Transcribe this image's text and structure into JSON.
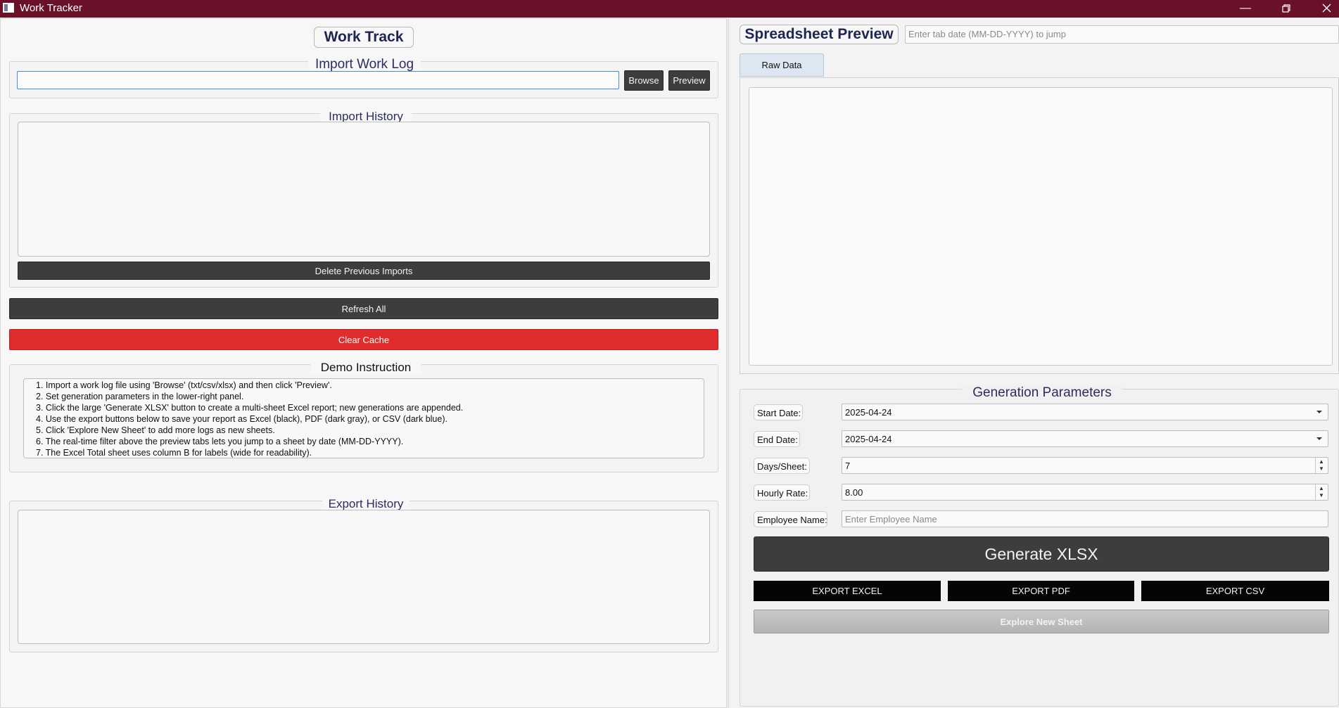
{
  "window": {
    "title": "Work Tracker"
  },
  "left": {
    "heading": "Work Track",
    "import": {
      "title": "Import Work Log",
      "path_value": "",
      "browse_label": "Browse",
      "preview_label": "Preview"
    },
    "import_history": {
      "title": "Import History",
      "delete_label": "Delete Previous Imports"
    },
    "refresh_label": "Refresh All",
    "clear_cache_label": "Clear Cache",
    "demo": {
      "title": "Demo Instruction",
      "lines": [
        "1. Import a work log file using 'Browse' (txt/csv/xlsx) and then click 'Preview'.",
        "2. Set generation parameters in the lower-right panel.",
        "3. Click the large 'Generate XLSX' button to create a multi-sheet Excel report; new generations are appended.",
        "4. Use the export buttons below to save your report as Excel (black), PDF (dark gray), or CSV (dark blue).",
        "5. Click 'Explore New Sheet' to add more logs as new sheets.",
        "6. The real-time filter above the preview tabs lets you jump to a sheet by date (MM-DD-YYYY).",
        "7. The Excel Total sheet uses column B for labels (wide for readability)."
      ]
    },
    "export_history": {
      "title": "Export History"
    }
  },
  "right": {
    "heading": "Spreadsheet Preview",
    "jump_placeholder": "Enter tab date (MM-DD-YYYY) to jump",
    "tabs": [
      {
        "label": "Raw Data"
      }
    ],
    "params": {
      "title": "Generation Parameters",
      "start_label": "Start Date:",
      "start_value": "2025-04-24",
      "end_label": "End Date:",
      "end_value": "2025-04-24",
      "days_label": "Days/Sheet:",
      "days_value": "7",
      "rate_label": "Hourly Rate:",
      "rate_value": "8.00",
      "name_label": "Employee Name:",
      "name_placeholder": "Enter Employee Name"
    },
    "generate_label": "Generate XLSX",
    "export_excel_label": "EXPORT EXCEL",
    "export_pdf_label": "EXPORT PDF",
    "export_csv_label": "EXPORT CSV",
    "explore_label": "Explore New Sheet"
  },
  "colors": {
    "titlebar": "#6b1029",
    "dark_button": "#3d3d3d",
    "clear_cache": "#e02c2c",
    "export_button": "#050505",
    "heading_text": "#1f2550"
  }
}
